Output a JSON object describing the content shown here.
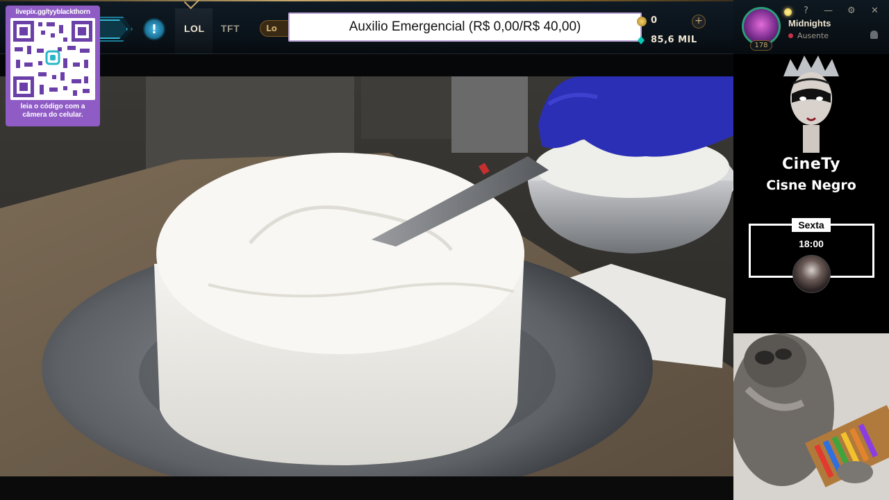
{
  "header": {
    "tabs": [
      {
        "label": "LOL",
        "active": true
      },
      {
        "label": "TFT",
        "active": false
      }
    ],
    "pill_label": "Lo",
    "alert_glyph": "!",
    "currency": {
      "rp": "0",
      "blue_essence": "85,6 MIL",
      "add_glyph": "+"
    }
  },
  "banner": {
    "text": "Auxilio Emergencial (R$ 0,00/R$ 40,00)"
  },
  "livepix": {
    "url": "livepix.gg/tyyblackthorn",
    "caption_line1": "leia o código com a",
    "caption_line2": "câmera do celular."
  },
  "profile": {
    "username": "Midnights",
    "status": "Ausente",
    "level": "178",
    "window_controls": [
      "?",
      "—",
      "⚙",
      "✕"
    ]
  },
  "schedule": {
    "title": "CineTy",
    "subtitle": "Cisne Negro",
    "day": "Sexta",
    "time": "18:00"
  },
  "colors": {
    "gold": "#c8aa6e",
    "teal": "#0ac8b9",
    "banner_border": "#b9a3d6",
    "livepix_purple": "#8f5cc6",
    "glove_blue": "#2b2fb5"
  },
  "icons": {
    "alert": "alert-circle-icon",
    "rp": "riot-points-icon",
    "be": "blue-essence-icon",
    "bell": "bell-icon",
    "settings": "gear-icon"
  }
}
